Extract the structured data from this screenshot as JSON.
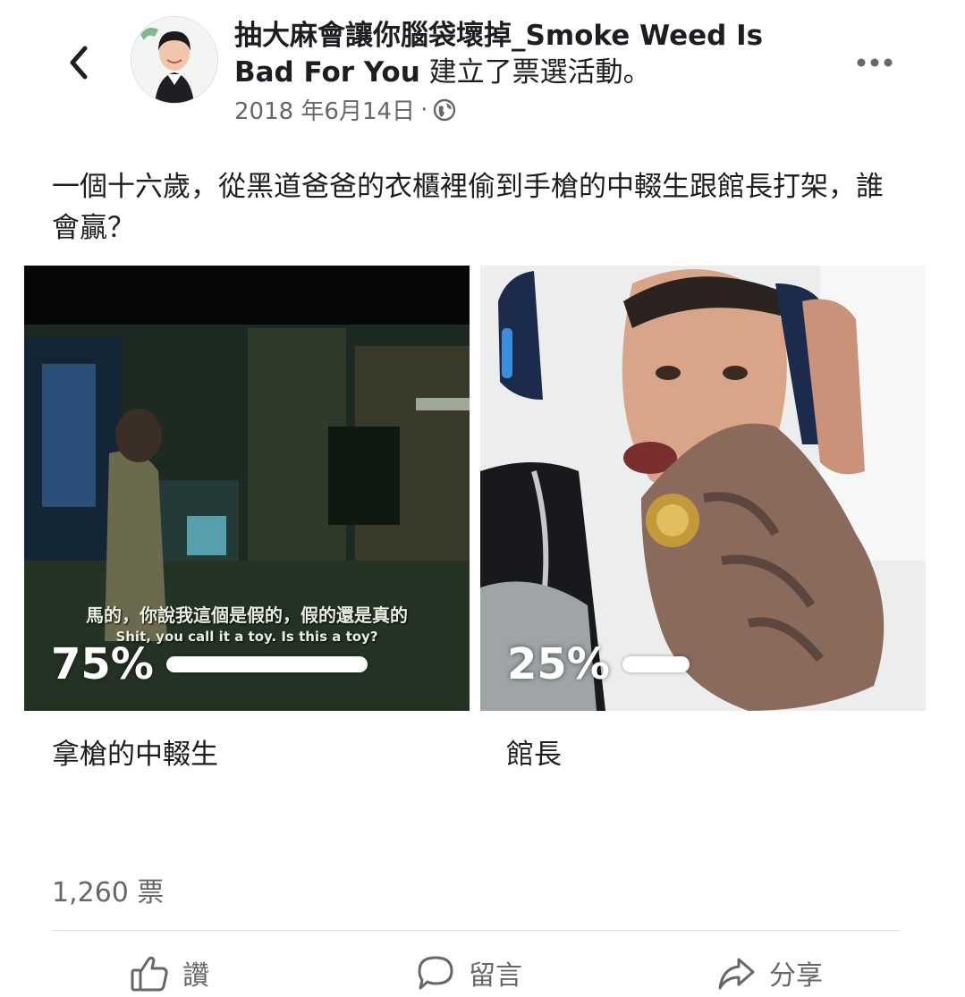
{
  "header": {
    "page_name": "抽大麻會讓你腦袋壞掉_Smoke Weed Is Bad For You",
    "action_text": " 建立了票選活動。",
    "date": "2018 年6月14日",
    "separator": "·",
    "privacy_icon": "globe-icon",
    "back_icon": "chevron-left-icon",
    "more_icon": "more-horizontal-icon"
  },
  "post": {
    "question": "一個十六歲，從黑道爸爸的衣櫃裡偷到手槍的中輟生跟館長打架，誰會贏？"
  },
  "poll": {
    "options": [
      {
        "label": "拿槍的中輟生",
        "percent_text": "75%",
        "share": 0.75,
        "subtitle_zh": "馬的，你說我這個是假的，假的還是真的",
        "subtitle_en": "Shit, you call it a toy. Is this a toy?"
      },
      {
        "label": "館長",
        "percent_text": "25%",
        "share": 0.25
      }
    ],
    "total_votes": "1,260 票"
  },
  "actions": {
    "like": "讚",
    "comment": "留言",
    "share": "分享"
  },
  "colors": {
    "text_primary": "#1c1e21",
    "text_secondary": "#65676b",
    "divider": "#dadde1",
    "bar": "#ffffff"
  }
}
